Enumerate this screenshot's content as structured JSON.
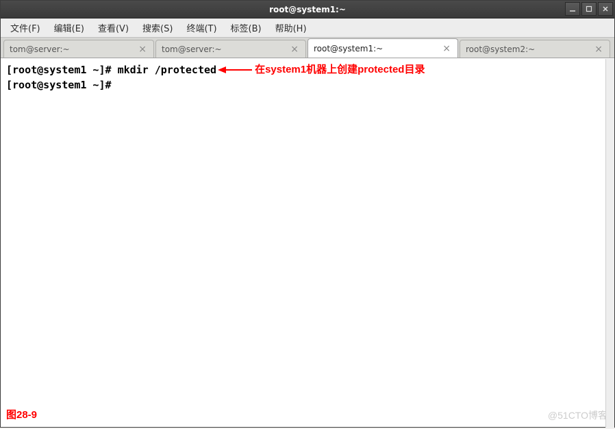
{
  "window": {
    "title": "root@system1:~"
  },
  "menubar": {
    "items": [
      {
        "label": "文件(F)"
      },
      {
        "label": "编辑(E)"
      },
      {
        "label": "查看(V)"
      },
      {
        "label": "搜索(S)"
      },
      {
        "label": "终端(T)"
      },
      {
        "label": "标签(B)"
      },
      {
        "label": "帮助(H)"
      }
    ]
  },
  "tabs": [
    {
      "label": "tom@server:~",
      "active": false
    },
    {
      "label": "tom@server:~",
      "active": false
    },
    {
      "label": "root@system1:~",
      "active": true
    },
    {
      "label": "root@system2:~",
      "active": false
    }
  ],
  "terminal": {
    "lines": [
      {
        "prompt": "[root@system1 ~]# ",
        "cmd": "mkdir /protected",
        "annotation": "在system1机器上创建protected目录"
      },
      {
        "prompt": "[root@system1 ~]# ",
        "cmd": "",
        "annotation": ""
      }
    ]
  },
  "figure_label": "图28-9",
  "watermark": "@51CTO博客"
}
